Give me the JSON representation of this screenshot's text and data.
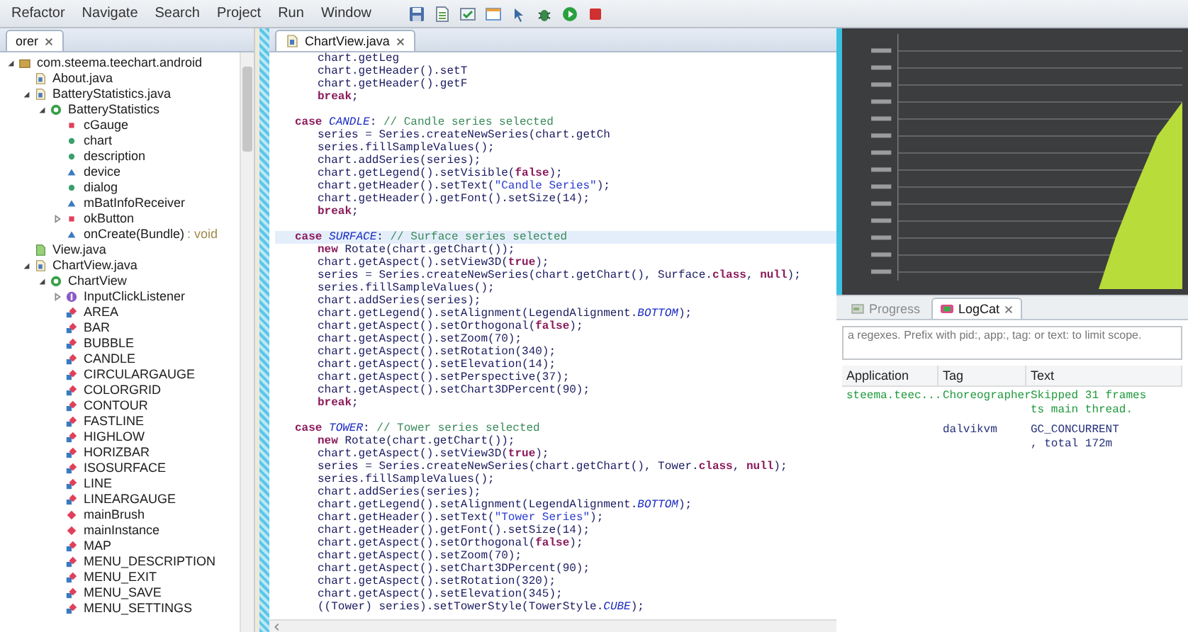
{
  "menu": [
    {
      "label": "Refactor"
    },
    {
      "label": "Navigate"
    },
    {
      "label": "Search"
    },
    {
      "label": "Project"
    },
    {
      "label": "Run"
    },
    {
      "label": "Window"
    }
  ],
  "explorer": {
    "tab": {
      "label": "orer",
      "selected": true
    },
    "tree": [
      {
        "label": "com.steema.teechart.android",
        "kind": "package",
        "expanded": true,
        "children": [
          {
            "label": "About.java",
            "kind": "java"
          },
          {
            "label": "BatteryStatistics.java",
            "kind": "java",
            "expanded": true,
            "children": [
              {
                "label": "BatteryStatistics",
                "kind": "class",
                "expanded": true,
                "children": [
                  {
                    "label": "cGauge",
                    "kind": "private"
                  },
                  {
                    "label": "chart",
                    "kind": "public"
                  },
                  {
                    "label": "description",
                    "kind": "public"
                  },
                  {
                    "label": "device",
                    "kind": "default"
                  },
                  {
                    "label": "dialog",
                    "kind": "public"
                  },
                  {
                    "label": "mBatInfoReceiver",
                    "kind": "default"
                  },
                  {
                    "label": "okButton",
                    "kind": "private",
                    "expanded": false
                  },
                  {
                    "label": "onCreate(Bundle)",
                    "detail": ": void",
                    "kind": "default"
                  }
                ]
              }
            ]
          },
          {
            "label": "View.java",
            "kind": "android"
          },
          {
            "label": "ChartView.java",
            "kind": "java",
            "expanded": true,
            "children": [
              {
                "label": "ChartView",
                "kind": "class",
                "expanded": true,
                "children": [
                  {
                    "label": "InputClickListener",
                    "kind": "interface",
                    "expanded": false
                  },
                  {
                    "label": "AREA",
                    "kind": "constant"
                  },
                  {
                    "label": "BAR",
                    "kind": "constant"
                  },
                  {
                    "label": "BUBBLE",
                    "kind": "constant"
                  },
                  {
                    "label": "CANDLE",
                    "kind": "constant"
                  },
                  {
                    "label": "CIRCULARGAUGE",
                    "kind": "constant"
                  },
                  {
                    "label": "COLORGRID",
                    "kind": "constant"
                  },
                  {
                    "label": "CONTOUR",
                    "kind": "constant"
                  },
                  {
                    "label": "FASTLINE",
                    "kind": "constant"
                  },
                  {
                    "label": "HIGHLOW",
                    "kind": "constant"
                  },
                  {
                    "label": "HORIZBAR",
                    "kind": "constant"
                  },
                  {
                    "label": "ISOSURFACE",
                    "kind": "constant"
                  },
                  {
                    "label": "LINE",
                    "kind": "constant"
                  },
                  {
                    "label": "LINEARGAUGE",
                    "kind": "constant"
                  },
                  {
                    "label": "mainBrush",
                    "kind": "static"
                  },
                  {
                    "label": "mainInstance",
                    "kind": "static"
                  },
                  {
                    "label": "MAP",
                    "kind": "constant"
                  },
                  {
                    "label": "MENU_DESCRIPTION",
                    "kind": "constant"
                  },
                  {
                    "label": "MENU_EXIT",
                    "kind": "constant"
                  },
                  {
                    "label": "MENU_SAVE",
                    "kind": "constant"
                  },
                  {
                    "label": "MENU_SETTINGS",
                    "kind": "constant"
                  }
                ]
              }
            ]
          }
        ]
      }
    ]
  },
  "editor": {
    "tab": {
      "label": "ChartView.java",
      "selected": true
    },
    "lines": [
      {
        "kind": "stmt",
        "current": false,
        "parts": [
          {
            "kind": "code",
            "text": "chart.getLeg"
          }
        ]
      },
      {
        "kind": "stmt",
        "current": false,
        "parts": [
          {
            "kind": "code",
            "text": "chart.getHeader().setT"
          }
        ]
      },
      {
        "kind": "stmt",
        "current": false,
        "parts": [
          {
            "kind": "code",
            "text": "chart.getHeader().getF"
          }
        ]
      },
      {
        "kind": "stmt",
        "current": false,
        "parts": [
          {
            "kind": "kw",
            "text": "break"
          },
          {
            "kind": "code",
            "text": ";"
          }
        ]
      },
      {
        "kind": "blank"
      },
      {
        "kind": "case",
        "current": false,
        "parts": [
          {
            "kind": "kw",
            "text": "case "
          },
          {
            "kind": "const",
            "text": "CANDLE"
          },
          {
            "kind": "code",
            "text": ": "
          },
          {
            "kind": "comment",
            "text": "// Candle series selected"
          }
        ]
      },
      {
        "kind": "stmt",
        "current": false,
        "parts": [
          {
            "kind": "code",
            "text": "series = Series.createNewSeries(chart.getCh"
          }
        ]
      },
      {
        "kind": "stmt",
        "current": false,
        "parts": [
          {
            "kind": "code",
            "text": "series.fillSampleValues();"
          }
        ]
      },
      {
        "kind": "stmt",
        "current": false,
        "parts": [
          {
            "kind": "code",
            "text": "chart.addSeries(series);"
          }
        ]
      },
      {
        "kind": "stmt",
        "current": false,
        "parts": [
          {
            "kind": "code",
            "text": "chart.getLegend().setVisible("
          },
          {
            "kind": "kw",
            "text": "false"
          },
          {
            "kind": "code",
            "text": ");"
          }
        ]
      },
      {
        "kind": "stmt",
        "current": false,
        "parts": [
          {
            "kind": "code",
            "text": "chart.getHeader().setText("
          },
          {
            "kind": "str",
            "text": "\"Candle Series\""
          },
          {
            "kind": "code",
            "text": ");"
          }
        ]
      },
      {
        "kind": "stmt",
        "current": false,
        "parts": [
          {
            "kind": "code",
            "text": "chart.getHeader().getFont().setSize(14);"
          }
        ]
      },
      {
        "kind": "stmt",
        "current": false,
        "parts": [
          {
            "kind": "kw",
            "text": "break"
          },
          {
            "kind": "code",
            "text": ";"
          }
        ]
      },
      {
        "kind": "blank"
      },
      {
        "kind": "case",
        "current": true,
        "parts": [
          {
            "kind": "kw",
            "text": "case "
          },
          {
            "kind": "const",
            "text": "SURFACE"
          },
          {
            "kind": "code",
            "text": ": "
          },
          {
            "kind": "comment",
            "text": "// Surface series selected"
          }
        ]
      },
      {
        "kind": "stmt",
        "current": false,
        "parts": [
          {
            "kind": "kw",
            "text": "new "
          },
          {
            "kind": "code",
            "text": "Rotate(chart.getChart());"
          }
        ]
      },
      {
        "kind": "stmt",
        "current": false,
        "parts": [
          {
            "kind": "code",
            "text": "chart.getAspect().setView3D("
          },
          {
            "kind": "kw",
            "text": "true"
          },
          {
            "kind": "code",
            "text": ");"
          }
        ]
      },
      {
        "kind": "stmt",
        "current": false,
        "parts": [
          {
            "kind": "code",
            "text": "series = Series.createNewSeries(chart.getChart(), Surface."
          },
          {
            "kind": "kw",
            "text": "class"
          },
          {
            "kind": "code",
            "text": ", "
          },
          {
            "kind": "kw",
            "text": "null"
          },
          {
            "kind": "code",
            "text": ");"
          }
        ]
      },
      {
        "kind": "stmt",
        "current": false,
        "parts": [
          {
            "kind": "code",
            "text": "series.fillSampleValues();"
          }
        ]
      },
      {
        "kind": "stmt",
        "current": false,
        "parts": [
          {
            "kind": "code",
            "text": "chart.addSeries(series);"
          }
        ]
      },
      {
        "kind": "stmt",
        "current": false,
        "parts": [
          {
            "kind": "code",
            "text": "chart.getLegend().setAlignment(LegendAlignment."
          },
          {
            "kind": "const",
            "text": "BOTTOM"
          },
          {
            "kind": "code",
            "text": ");"
          }
        ]
      },
      {
        "kind": "stmt",
        "current": false,
        "parts": [
          {
            "kind": "code",
            "text": "chart.getAspect().setOrthogonal("
          },
          {
            "kind": "kw",
            "text": "false"
          },
          {
            "kind": "code",
            "text": ");"
          }
        ]
      },
      {
        "kind": "stmt",
        "current": false,
        "parts": [
          {
            "kind": "code",
            "text": "chart.getAspect().setZoom(70);"
          }
        ]
      },
      {
        "kind": "stmt",
        "current": false,
        "parts": [
          {
            "kind": "code",
            "text": "chart.getAspect().setRotation(340);"
          }
        ]
      },
      {
        "kind": "stmt",
        "current": false,
        "parts": [
          {
            "kind": "code",
            "text": "chart.getAspect().setElevation(14);"
          }
        ]
      },
      {
        "kind": "stmt",
        "current": false,
        "parts": [
          {
            "kind": "code",
            "text": "chart.getAspect().setPerspective(37);"
          }
        ]
      },
      {
        "kind": "stmt",
        "current": false,
        "parts": [
          {
            "kind": "code",
            "text": "chart.getAspect().setChart3DPercent(90);"
          }
        ]
      },
      {
        "kind": "stmt",
        "current": false,
        "parts": [
          {
            "kind": "kw",
            "text": "break"
          },
          {
            "kind": "code",
            "text": ";"
          }
        ]
      },
      {
        "kind": "blank"
      },
      {
        "kind": "case",
        "current": false,
        "parts": [
          {
            "kind": "kw",
            "text": "case "
          },
          {
            "kind": "const",
            "text": "TOWER"
          },
          {
            "kind": "code",
            "text": ": "
          },
          {
            "kind": "comment",
            "text": "// Tower series selected"
          }
        ]
      },
      {
        "kind": "stmt",
        "current": false,
        "parts": [
          {
            "kind": "kw",
            "text": "new "
          },
          {
            "kind": "code",
            "text": "Rotate(chart.getChart());"
          }
        ]
      },
      {
        "kind": "stmt",
        "current": false,
        "parts": [
          {
            "kind": "code",
            "text": "chart.getAspect().setView3D("
          },
          {
            "kind": "kw",
            "text": "true"
          },
          {
            "kind": "code",
            "text": ");"
          }
        ]
      },
      {
        "kind": "stmt",
        "current": false,
        "parts": [
          {
            "kind": "code",
            "text": "series = Series.createNewSeries(chart.getChart(), Tower."
          },
          {
            "kind": "kw",
            "text": "class"
          },
          {
            "kind": "code",
            "text": ", "
          },
          {
            "kind": "kw",
            "text": "null"
          },
          {
            "kind": "code",
            "text": ");"
          }
        ]
      },
      {
        "kind": "stmt",
        "current": false,
        "parts": [
          {
            "kind": "code",
            "text": "series.fillSampleValues();"
          }
        ]
      },
      {
        "kind": "stmt",
        "current": false,
        "parts": [
          {
            "kind": "code",
            "text": "chart.addSeries(series);"
          }
        ]
      },
      {
        "kind": "stmt",
        "current": false,
        "parts": [
          {
            "kind": "code",
            "text": "chart.getLegend().setAlignment(LegendAlignment."
          },
          {
            "kind": "const",
            "text": "BOTTOM"
          },
          {
            "kind": "code",
            "text": ");"
          }
        ]
      },
      {
        "kind": "stmt",
        "current": false,
        "parts": [
          {
            "kind": "code",
            "text": "chart.getHeader().setText("
          },
          {
            "kind": "str",
            "text": "\"Tower Series\""
          },
          {
            "kind": "code",
            "text": ");"
          }
        ]
      },
      {
        "kind": "stmt",
        "current": false,
        "parts": [
          {
            "kind": "code",
            "text": "chart.getHeader().getFont().setSize(14);"
          }
        ]
      },
      {
        "kind": "stmt",
        "current": false,
        "parts": [
          {
            "kind": "code",
            "text": "chart.getAspect().setOrthogonal("
          },
          {
            "kind": "kw",
            "text": "false"
          },
          {
            "kind": "code",
            "text": ");"
          }
        ]
      },
      {
        "kind": "stmt",
        "current": false,
        "parts": [
          {
            "kind": "code",
            "text": "chart.getAspect().setZoom(70);"
          }
        ]
      },
      {
        "kind": "stmt",
        "current": false,
        "parts": [
          {
            "kind": "code",
            "text": "chart.getAspect().setChart3DPercent(90);"
          }
        ]
      },
      {
        "kind": "stmt",
        "current": false,
        "parts": [
          {
            "kind": "code",
            "text": "chart.getAspect().setRotation(320);"
          }
        ]
      },
      {
        "kind": "stmt",
        "current": false,
        "parts": [
          {
            "kind": "code",
            "text": "chart.getAspect().setElevation(345);"
          }
        ]
      },
      {
        "kind": "stmt",
        "current": false,
        "parts": [
          {
            "kind": "code",
            "text": "((Tower) series).setTowerStyle(TowerStyle."
          },
          {
            "kind": "const",
            "text": "CUBE"
          },
          {
            "kind": "code",
            "text": ");"
          }
        ]
      }
    ]
  },
  "bottom_panel": {
    "tabs": [
      {
        "label": "Progress",
        "kind": "progress",
        "selected": false
      },
      {
        "label": "LogCat",
        "kind": "logcat",
        "selected": true
      }
    ],
    "filter": {
      "placeholder": "a regexes. Prefix with pid:, app:, tag: or text: to limit scope."
    },
    "columns": [
      "Application",
      "Tag",
      "Text"
    ],
    "rows": [
      {
        "application": "steema.teec...",
        "tag": "Choreographer",
        "text_lines": [
          "Skipped 31 frames",
          "ts main thread."
        ],
        "color": "#1f9a3c"
      },
      {
        "tag": "dalvikvm",
        "text_lines": [
          "GC_CONCURRENT",
          ", total 172m"
        ],
        "color": "#25307a"
      }
    ]
  }
}
